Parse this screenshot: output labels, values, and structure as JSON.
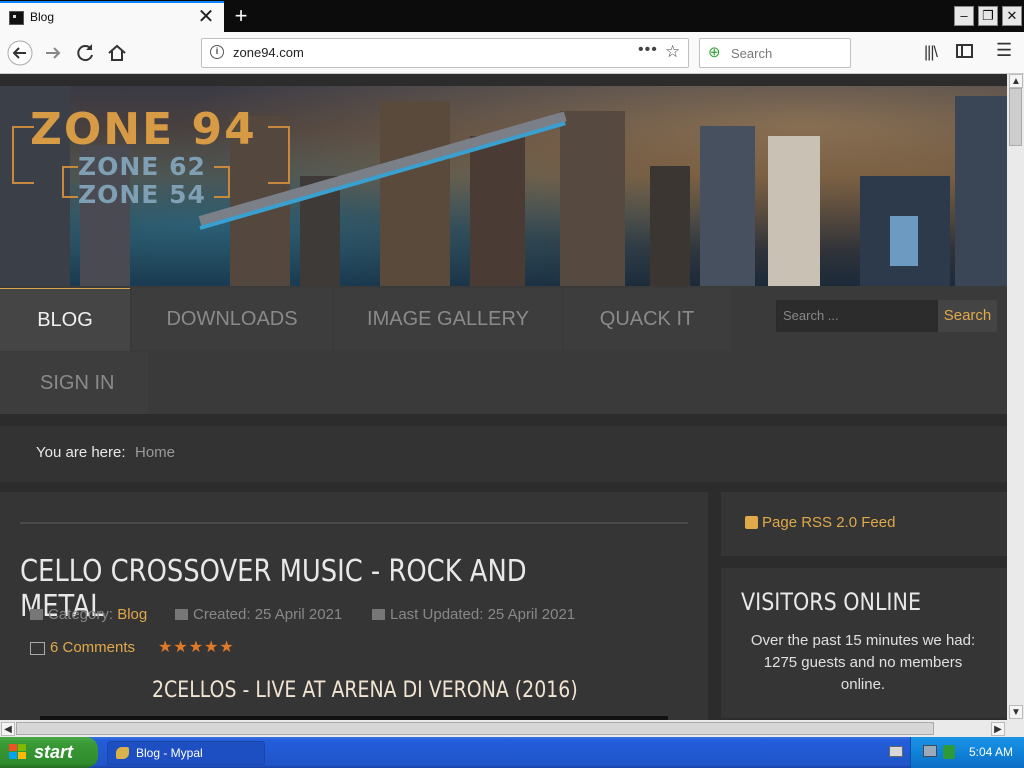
{
  "browser": {
    "tab_title": "Blog",
    "tab_close": "✕",
    "new_tab": "+",
    "url": "zone94.com",
    "url_more": "•••",
    "url_info": "i",
    "search_placeholder": "Search",
    "window_controls": [
      "–",
      "❐",
      "✕"
    ],
    "nav_icons": [
      "back-icon",
      "forward-icon",
      "reload-icon",
      "home-icon",
      "library-icon",
      "sidebar-icon",
      "menu-icon",
      "star-icon"
    ]
  },
  "site": {
    "logo_main": "ZONE 94",
    "logo_sub1": "ZONE 62",
    "logo_sub2": "ZONE 54",
    "menu": [
      {
        "label": "BLOG",
        "active": true
      },
      {
        "label": "DOWNLOADS",
        "active": false
      },
      {
        "label": "IMAGE GALLERY",
        "active": false
      },
      {
        "label": "QUACK IT",
        "active": false
      },
      {
        "label": "SIGN IN",
        "active": false
      }
    ],
    "search_placeholder": "Search ...",
    "search_button": "Search",
    "accent_color": "#e0a94a"
  },
  "breadcrumb": {
    "label": "You are here:",
    "home": "Home"
  },
  "article": {
    "title": "CELLO CROSSOVER MUSIC - ROCK AND METAL",
    "category_label": "Category:",
    "category_value": "Blog",
    "created": "Created: 25 April 2021",
    "updated": "Last Updated: 25 April 2021",
    "comments": "6 Comments",
    "rating_stars": 5,
    "rating": "★★★★★",
    "subtitle": "2CELLOS - LIVE AT ARENA DI VERONA (2016)"
  },
  "sidebar": {
    "rss": "Page RSS 2.0 Feed",
    "visitors_title": "VISITORS ONLINE",
    "visitors_text": "Over the past 15 minutes we had: 1275 guests and no members online."
  },
  "taskbar": {
    "start": "start",
    "task_label": "Blog - Mypal",
    "clock": "5:04 AM"
  }
}
